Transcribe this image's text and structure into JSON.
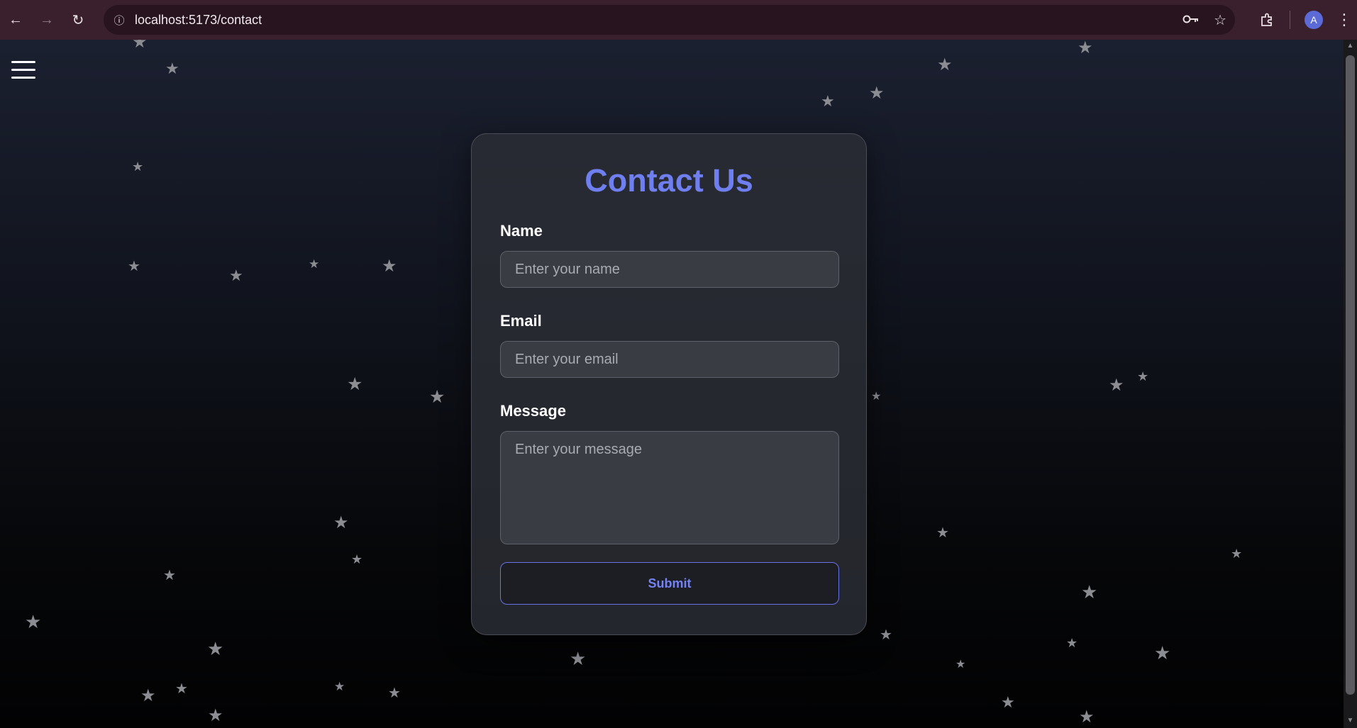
{
  "browser": {
    "url": "localhost:5173/contact",
    "avatar_letter": "A"
  },
  "contact": {
    "title": "Contact Us",
    "name_label": "Name",
    "name_placeholder": "Enter your name",
    "email_label": "Email",
    "email_placeholder": "Enter your email",
    "message_label": "Message",
    "message_placeholder": "Enter your message",
    "submit_label": "Submit"
  },
  "colors": {
    "accent": "#6f7ff0",
    "chrome": "#3a1f2c"
  }
}
